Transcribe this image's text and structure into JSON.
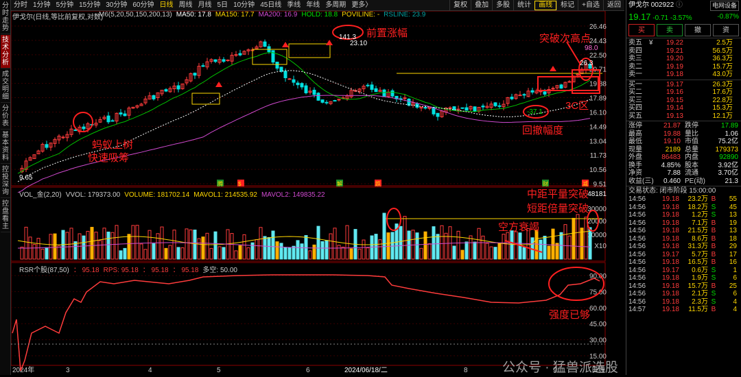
{
  "left_tabs": [
    "分时走势",
    "技术分析",
    "成交明细",
    "分价表",
    "基本资料",
    "控投深询",
    "控盘看主"
  ],
  "toolbar": {
    "periods": [
      "分时",
      "1分钟",
      "5分钟",
      "15分钟",
      "30分钟",
      "60分钟",
      "日线",
      "周线",
      "月线",
      "5日",
      "10分钟",
      "45日线",
      "季线",
      "年线",
      "多周期",
      "更多〉"
    ],
    "active_period": "日线",
    "right_buttons": [
      "复权",
      "叠加",
      "多股",
      "统计",
      "画线",
      "标记",
      "+自选",
      "返回"
    ],
    "active_right": "画线"
  },
  "chart_title": "伊戈尔(日线,等比前复权,对数)",
  "ma_legend": [
    {
      "text": "M6(5,20,50,150,200,13)",
      "color": "#cccccc"
    },
    {
      "text": "MA50: 17.8",
      "color": "#ffffff"
    },
    {
      "text": "MA150: 17.7",
      "color": "#ffd700"
    },
    {
      "text": "MA200: 16.9",
      "color": "#d04ad0"
    },
    {
      "text": "HOLD: 18.8",
      "color": "#00e000"
    },
    {
      "text": "POVILINE: -",
      "color": "#ffd700"
    },
    {
      "text": "RSLINE: 23.9",
      "color": "#00a0a0"
    }
  ],
  "price_axis": [
    "26.46",
    "24.43",
    "22.50",
    "20.71",
    "19.88",
    "17.89",
    "16.10",
    "14.49",
    "13.04",
    "11.73",
    "10.56",
    "9.51"
  ],
  "price_labels": {
    "high_box": "141.3",
    "high_price": "23.10",
    "low_price": "9.65",
    "pullback": "-37.1",
    "rs_value": "98.0",
    "ticks_val": "26.3"
  },
  "vol_legend": [
    {
      "text": "VOL_金(2,20)",
      "color": "#cccccc"
    },
    {
      "text": "VVOL: 179373.00",
      "color": "#cccccc"
    },
    {
      "text": "VOLUME: 181702.14",
      "color": "#ffd700"
    },
    {
      "text": "MAVOL1: 214535.92",
      "color": "#ffd700"
    },
    {
      "text": "MAVOL2: 149835.22",
      "color": "#d04ad0"
    }
  ],
  "vol_axis": [
    "48181",
    "30000",
    "20000",
    "10000",
    "X10"
  ],
  "rsr_legend": [
    {
      "text": "RSR个股(87,50)",
      "color": "#cccccc"
    },
    {
      "text": "： 95.18",
      "color": "#ff3c3c"
    },
    {
      "text": "RPS: 95.18",
      "color": "#ff3c3c"
    },
    {
      "text": "： 95.18",
      "color": "#ff3c3c"
    },
    {
      "text": "： 95.18",
      "color": "#ff3c3c"
    },
    {
      "text": "多空: 50.00",
      "color": "#cccccc"
    }
  ],
  "rsr_axis": [
    "90.00",
    "75.00",
    "60.00",
    "45.00",
    "30.00",
    "15.00"
  ],
  "date_axis": [
    "2024年",
    "3",
    "4",
    "5",
    "6",
    "2024/06/18/二",
    "8",
    "9",
    "日线"
  ],
  "event_markers": [
    "腾",
    "$",
    "解",
    "跌",
    "财",
    "减"
  ],
  "annotations": {
    "ant": "蚂蚁上树",
    "ant2": "快速吸筹",
    "front": "前置涨幅",
    "break_high": "突破次高点",
    "zone": "3C区",
    "pullback": "回撤幅度",
    "vol_break1": "中距平量突破",
    "vol_break2": "短距倍量突破",
    "short_dry": "空方衰竭",
    "strength": "强度已够"
  },
  "watermark": "公众号 · 猛兽派选股",
  "quote": {
    "name": "伊戈尔",
    "code": "002922",
    "tag": "电网设备",
    "price": "19.17",
    "chg": "-0.71",
    "pct": "-3.57%",
    "sector_pct": "-0.87%",
    "buttons": [
      "买",
      "卖",
      "撤",
      "资"
    ],
    "asks": [
      [
        "卖五",
        "¥",
        "19.22",
        "2.5万"
      ],
      [
        "卖四",
        "",
        "19.21",
        "56.5万"
      ],
      [
        "卖三",
        "",
        "19.20",
        "36.3万"
      ],
      [
        "卖二",
        "",
        "19.19",
        "15.7万"
      ],
      [
        "卖一",
        "",
        "19.18",
        "43.0万"
      ]
    ],
    "bids": [
      [
        "买一",
        "19.17",
        "26.3万"
      ],
      [
        "买二",
        "19.16",
        "17.6万"
      ],
      [
        "买三",
        "19.15",
        "22.8万"
      ],
      [
        "买四",
        "19.14",
        "15.3万"
      ],
      [
        "买五",
        "19.13",
        "12.1万"
      ]
    ],
    "stats": [
      [
        "涨停",
        "21.87",
        "跌停",
        "17.89"
      ],
      [
        "最高",
        "19.88",
        "量比",
        "1.06"
      ],
      [
        "最低",
        "19.10",
        "市值",
        "75.2亿"
      ],
      [
        "现量",
        "2189",
        "总量",
        "179373"
      ],
      [
        "外盘",
        "86483",
        "内盘",
        "92890"
      ],
      [
        "换手",
        "4.85%",
        "股本",
        "3.92亿"
      ],
      [
        "净资",
        "7.88",
        "流通",
        "3.70亿"
      ],
      [
        "收益(三)",
        "0.460",
        "PE(动)",
        "21.3"
      ]
    ],
    "trade_header": "交易状态: 闭市阶段 15:00:00",
    "trades": [
      [
        "14:56",
        "19.18",
        "23.2万",
        "B",
        "55"
      ],
      [
        "14:56",
        "19.18",
        "18.2万",
        "S",
        "45"
      ],
      [
        "14:56",
        "19.18",
        "1.2万",
        "S",
        "13"
      ],
      [
        "14:56",
        "19.18",
        "7.1万",
        "B",
        "19"
      ],
      [
        "14:56",
        "19.18",
        "21.5万",
        "B",
        "13"
      ],
      [
        "14:56",
        "19.18",
        "8.6万",
        "B",
        "18"
      ],
      [
        "14:56",
        "19.18",
        "31.3万",
        "B",
        "29"
      ],
      [
        "14:56",
        "19.17",
        "5.7万",
        "B",
        "17"
      ],
      [
        "14:56",
        "19.18",
        "16.5万",
        "B",
        "16"
      ],
      [
        "14:56",
        "19.17",
        "0.6万",
        "S",
        "1"
      ],
      [
        "14:56",
        "19.18",
        "1.9万",
        "S",
        "6"
      ],
      [
        "14:56",
        "19.18",
        "15.7万",
        "B",
        "25"
      ],
      [
        "14:56",
        "19.18",
        "2.1万",
        "S",
        "6"
      ],
      [
        "14:56",
        "19.18",
        "2.3万",
        "S",
        "4"
      ],
      [
        "14:57",
        "19.18",
        "11.5万",
        "B",
        "4"
      ]
    ]
  },
  "colors": {
    "up": "#ff3c3c",
    "down": "#00e0e0",
    "ma50": "#ffffff",
    "ma150": "#ffd700",
    "ma200": "#d04ad0",
    "hold": "#00c000",
    "annotation": "#ff2020",
    "grid": "#8b0000"
  }
}
